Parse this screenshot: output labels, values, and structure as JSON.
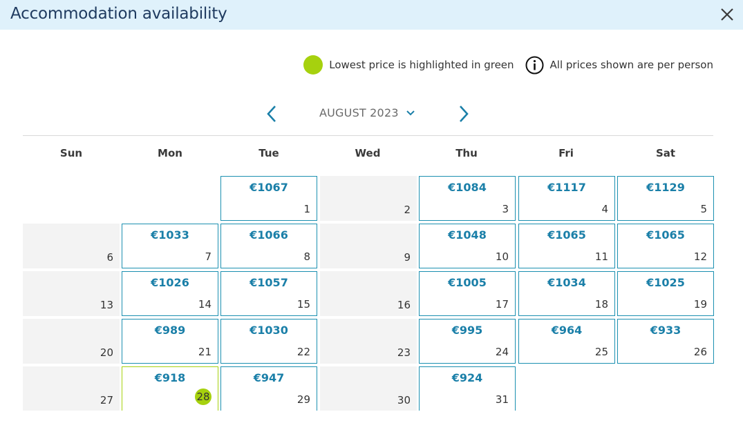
{
  "header": {
    "title": "Accommodation availability"
  },
  "legend": {
    "lowest_text": "Lowest price is highlighted in green",
    "per_person_text": "All prices shown are per person"
  },
  "nav": {
    "month": "AUGUST 2023"
  },
  "weekdays": [
    "Sun",
    "Mon",
    "Tue",
    "Wed",
    "Thu",
    "Fri",
    "Sat"
  ],
  "colors": {
    "accent": "#1a7fa8",
    "lowest": "#a6d10e",
    "header_bg": "#dff1fb"
  },
  "weeks": [
    [
      null,
      null,
      {
        "day": "1",
        "price": "€1067"
      },
      {
        "day": "2"
      },
      {
        "day": "3",
        "price": "€1084"
      },
      {
        "day": "4",
        "price": "€1117"
      },
      {
        "day": "5",
        "price": "€1129"
      }
    ],
    [
      {
        "day": "6"
      },
      {
        "day": "7",
        "price": "€1033"
      },
      {
        "day": "8",
        "price": "€1066"
      },
      {
        "day": "9"
      },
      {
        "day": "10",
        "price": "€1048"
      },
      {
        "day": "11",
        "price": "€1065"
      },
      {
        "day": "12",
        "price": "€1065"
      }
    ],
    [
      {
        "day": "13"
      },
      {
        "day": "14",
        "price": "€1026"
      },
      {
        "day": "15",
        "price": "€1057"
      },
      {
        "day": "16"
      },
      {
        "day": "17",
        "price": "€1005"
      },
      {
        "day": "18",
        "price": "€1034"
      },
      {
        "day": "19",
        "price": "€1025"
      }
    ],
    [
      {
        "day": "20"
      },
      {
        "day": "21",
        "price": "€989"
      },
      {
        "day": "22",
        "price": "€1030"
      },
      {
        "day": "23"
      },
      {
        "day": "24",
        "price": "€995"
      },
      {
        "day": "25",
        "price": "€964"
      },
      {
        "day": "26",
        "price": "€933"
      }
    ],
    [
      {
        "day": "27"
      },
      {
        "day": "28",
        "price": "€918",
        "lowest": true
      },
      {
        "day": "29",
        "price": "€947"
      },
      {
        "day": "30"
      },
      {
        "day": "31",
        "price": "€924"
      },
      null,
      null
    ]
  ]
}
